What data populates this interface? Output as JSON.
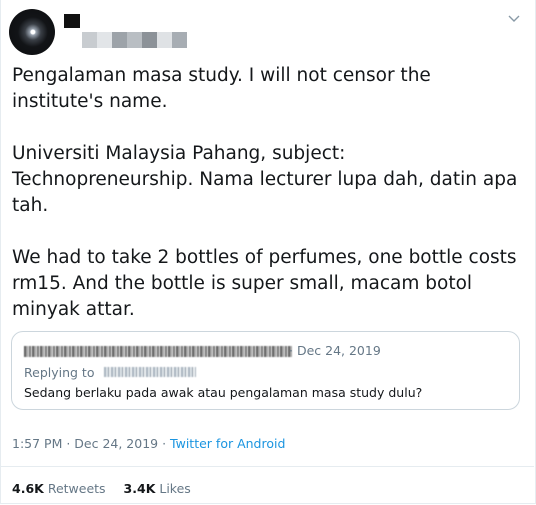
{
  "tweet": {
    "paragraphs": [
      "Pengalaman masa study. I will not censor the institute's name.",
      "Universiti Malaysia Pahang, subject: Technopreneurship. Nama lecturer lupa dah, datin apa tah.",
      "We had to take 2 bottles of perfumes, one bottle costs rm15. And the bottle is super small, macam botol minyak attar."
    ],
    "time": "1:57 PM",
    "date": "Dec 24, 2019",
    "source": "Twitter for Android"
  },
  "quoted": {
    "date": "Dec 24, 2019",
    "replying_label": "Replying to",
    "text": "Sedang berlaku pada awak atau pengalaman masa study dulu?"
  },
  "stats": {
    "retweets_count": "4.6K",
    "retweets_label": "Retweets",
    "likes_count": "3.4K",
    "likes_label": "Likes"
  },
  "handle_blur_colors": [
    "#c8ccd0",
    "#e2e5e8",
    "#9da3a9",
    "#b9bec3",
    "#8c9298",
    "#dfe2e5",
    "#a7adb3"
  ]
}
